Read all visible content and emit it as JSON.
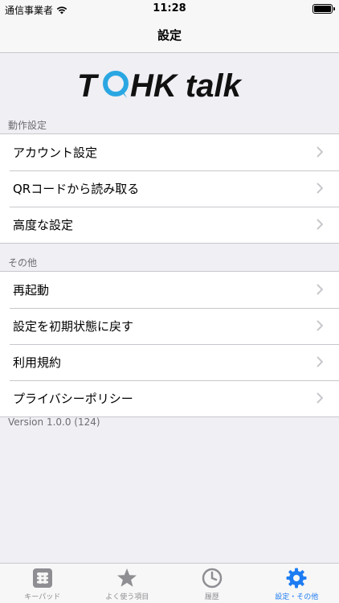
{
  "status_bar": {
    "carrier": "通信事業者",
    "time": "11:28"
  },
  "nav": {
    "title": "設定"
  },
  "logo": {
    "text": "TOHK talk"
  },
  "sections": [
    {
      "header": "動作設定",
      "items": [
        {
          "label": "アカウント設定"
        },
        {
          "label": "QRコードから読み取る"
        },
        {
          "label": "高度な設定"
        }
      ]
    },
    {
      "header": "その他",
      "items": [
        {
          "label": "再起動"
        },
        {
          "label": "設定を初期状態に戻す"
        },
        {
          "label": "利用規約"
        },
        {
          "label": "プライバシーポリシー"
        }
      ]
    }
  ],
  "version": "Version 1.0.0 (124)",
  "tabs": [
    {
      "label": "キーパッド",
      "icon": "keypad-icon"
    },
    {
      "label": "よく使う項目",
      "icon": "star-icon"
    },
    {
      "label": "履歴",
      "icon": "clock-icon"
    },
    {
      "label": "設定・その他",
      "icon": "gear-icon",
      "active": true
    }
  ],
  "colors": {
    "accent": "#1e7cf2",
    "logo_blue": "#2aa7e2",
    "tab_inactive": "#8e8e93"
  }
}
